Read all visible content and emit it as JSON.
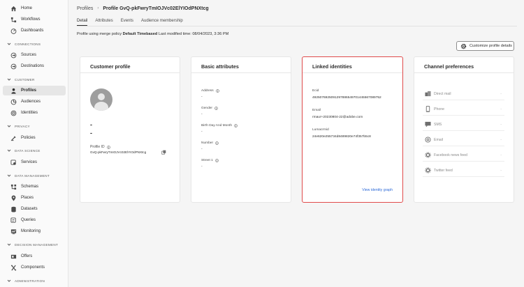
{
  "sidebar": {
    "items": [
      {
        "label": "Home",
        "icon": "home-icon"
      },
      {
        "label": "Workflows",
        "icon": "workflows-icon"
      },
      {
        "label": "Dashboards",
        "icon": "dashboards-icon"
      },
      {
        "label": "Sources",
        "icon": "sources-icon"
      },
      {
        "label": "Destinations",
        "icon": "destinations-icon"
      },
      {
        "label": "Profiles",
        "icon": "profiles-icon"
      },
      {
        "label": "Audiences",
        "icon": "audiences-icon"
      },
      {
        "label": "Identities",
        "icon": "identities-icon"
      },
      {
        "label": "Policies",
        "icon": "policies-icon"
      },
      {
        "label": "Services",
        "icon": "services-icon"
      },
      {
        "label": "Schemas",
        "icon": "schemas-icon"
      },
      {
        "label": "Places",
        "icon": "places-icon"
      },
      {
        "label": "Datasets",
        "icon": "datasets-icon"
      },
      {
        "label": "Queries",
        "icon": "queries-icon"
      },
      {
        "label": "Monitoring",
        "icon": "monitoring-icon"
      },
      {
        "label": "Offers",
        "icon": "offers-icon"
      },
      {
        "label": "Components",
        "icon": "components-icon"
      }
    ],
    "sections": [
      "CONNECTIONS",
      "CUSTOMER",
      "PRIVACY",
      "DATA SCIENCE",
      "DATA MANAGEMENT",
      "DECISION MANAGEMENT",
      "ADMINISTRATION"
    ],
    "active_item": "Profiles"
  },
  "breadcrumb": {
    "parent": "Profiles",
    "current": "Profile GvQ-pkFwryTmIOJVc02ElYIOdPNXtcg"
  },
  "tabs": [
    "Detail",
    "Attributes",
    "Events",
    "Audience membership"
  ],
  "active_tab": "Detail",
  "merge": {
    "prefix": "Profile using merge policy",
    "policy": "Default Timebased",
    "modified": "Last modified time: 08/04/2023, 3:36 PM"
  },
  "customize_button": "Customize profile details",
  "customer_profile": {
    "title": "Customer profile",
    "name_line1": "-",
    "name_line2": "-",
    "profile_id_label": "Profile ID",
    "profile_id": "GvQ-pkFwryTmIOJVc02ElYIOdPNXtcg"
  },
  "basic_attributes": {
    "title": "Basic attributes",
    "fields": [
      {
        "label": "Address",
        "value": "-"
      },
      {
        "label": "Gender",
        "value": "-"
      },
      {
        "label": "Birth Day And Month",
        "value": "-"
      },
      {
        "label": "Number",
        "value": "-"
      },
      {
        "label": "Street 1",
        "value": "-"
      }
    ]
  },
  "linked_identities": {
    "title": "Linked identities",
    "ids": [
      {
        "label": "Ecid",
        "value": "49250769250912978865497014455670897​52"
      },
      {
        "label": "Email",
        "value": "rmaur+20230804-22@adobe.com"
      },
      {
        "label": "Lumacrmid",
        "value": "24e620e255734d8489820e74f357b5c8"
      }
    ],
    "view_link": "View identity graph"
  },
  "channel_preferences": {
    "title": "Channel preferences",
    "channels": [
      {
        "label": "Direct mail",
        "icon": "direct-mail-icon",
        "value": "-"
      },
      {
        "label": "Phone",
        "icon": "phone-icon",
        "value": "-"
      },
      {
        "label": "SMS",
        "icon": "sms-icon",
        "value": "-"
      },
      {
        "label": "Email",
        "icon": "email-icon",
        "value": "-"
      },
      {
        "label": "Facebook news feed",
        "icon": "facebook-icon",
        "value": "-"
      },
      {
        "label": "Twitter feed",
        "icon": "twitter-icon",
        "value": "-"
      }
    ]
  },
  "colors": {
    "highlight": "#e04a4a",
    "link": "#2d6ad8",
    "active_nav": "#e6e6e6"
  }
}
